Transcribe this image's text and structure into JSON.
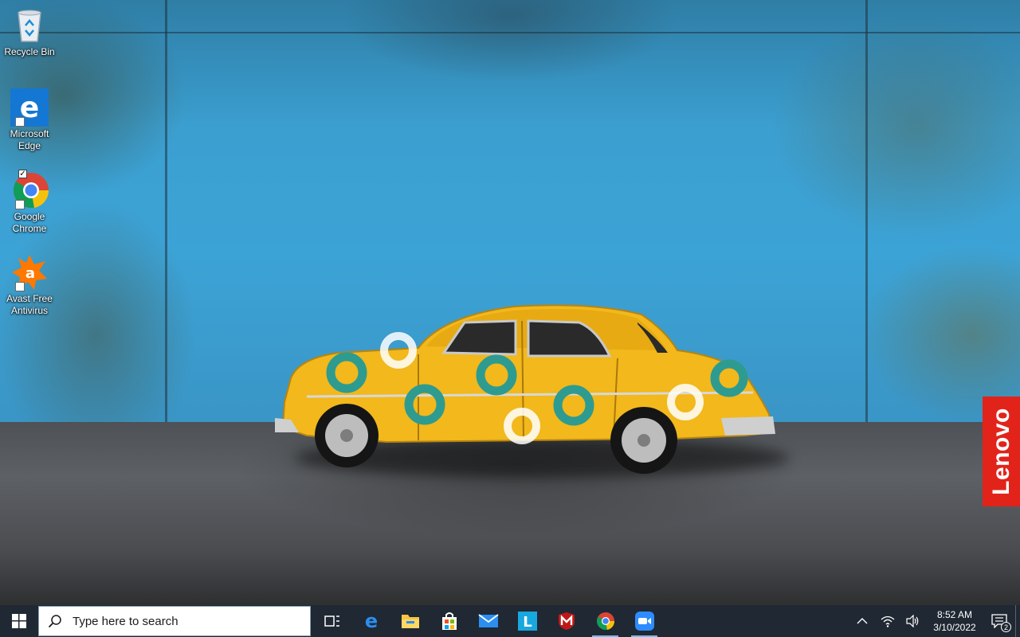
{
  "desktop": {
    "icons": [
      {
        "label": "Recycle Bin",
        "icon": "recycle-bin-icon"
      },
      {
        "label": "Microsoft Edge",
        "icon": "edge-icon"
      },
      {
        "label": "Google Chrome",
        "icon": "chrome-icon"
      },
      {
        "label": "Avast Free Antivirus",
        "icon": "avast-icon"
      }
    ]
  },
  "wallpaper": {
    "brand_text": "Lenovo",
    "colors": {
      "wall": "#3ca3d6",
      "car": "#f2b81c",
      "brand": "#e2231a"
    }
  },
  "taskbar": {
    "search_placeholder": "Type here to search",
    "pinned": [
      {
        "name": "task-view",
        "icon": "task-view-icon"
      },
      {
        "name": "edge",
        "icon": "edge-icon"
      },
      {
        "name": "file-explorer",
        "icon": "folder-icon"
      },
      {
        "name": "microsoft-store",
        "icon": "store-icon"
      },
      {
        "name": "mail",
        "icon": "mail-icon"
      },
      {
        "name": "lenovo-vantage",
        "icon": "lenovo-l-icon"
      },
      {
        "name": "mcafee",
        "icon": "mcafee-icon"
      },
      {
        "name": "chrome",
        "icon": "chrome-icon",
        "active": true
      },
      {
        "name": "zoom",
        "icon": "zoom-icon",
        "active": true
      }
    ],
    "tray": {
      "time": "8:52 AM",
      "date": "3/10/2022",
      "notification_count": "2"
    },
    "colors": {
      "background": "#202833",
      "active_indicator": "#76b9ed"
    }
  }
}
